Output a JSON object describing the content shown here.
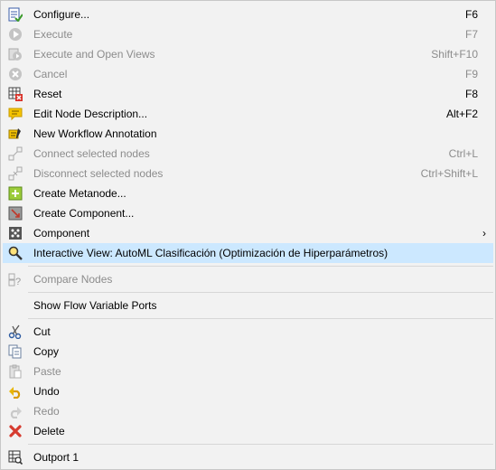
{
  "menu": {
    "items": [
      {
        "label": "Configure...",
        "shortcut": "F6",
        "icon": "configure-icon",
        "disabled": false
      },
      {
        "label": "Execute",
        "shortcut": "F7",
        "icon": "execute-icon",
        "disabled": true
      },
      {
        "label": "Execute and Open Views",
        "shortcut": "Shift+F10",
        "icon": "execute-open-views-icon",
        "disabled": true
      },
      {
        "label": "Cancel",
        "shortcut": "F9",
        "icon": "cancel-icon",
        "disabled": true
      },
      {
        "label": "Reset",
        "shortcut": "F8",
        "icon": "reset-icon",
        "disabled": false
      },
      {
        "label": "Edit Node Description...",
        "shortcut": "Alt+F2",
        "icon": "edit-description-icon",
        "disabled": false
      },
      {
        "label": "New Workflow Annotation",
        "shortcut": "",
        "icon": "annotation-icon",
        "disabled": false
      },
      {
        "label": "Connect selected nodes",
        "shortcut": "Ctrl+L",
        "icon": "connect-nodes-icon",
        "disabled": true
      },
      {
        "label": "Disconnect selected nodes",
        "shortcut": "Ctrl+Shift+L",
        "icon": "disconnect-nodes-icon",
        "disabled": true
      },
      {
        "label": "Create Metanode...",
        "shortcut": "",
        "icon": "metanode-icon",
        "disabled": false
      },
      {
        "label": "Create Component...",
        "shortcut": "",
        "icon": "component-create-icon",
        "disabled": false
      },
      {
        "label": "Component",
        "shortcut": "",
        "icon": "component-icon",
        "disabled": false
      },
      {
        "label": "Interactive View: AutoML Clasificación (Optimización de Hiperparámetros)",
        "shortcut": "",
        "icon": "interactive-view-icon",
        "disabled": false
      },
      {
        "label": "Compare Nodes",
        "shortcut": "",
        "icon": "compare-nodes-icon",
        "disabled": true
      },
      {
        "label": "Show Flow Variable Ports",
        "shortcut": "",
        "icon": "",
        "disabled": false
      },
      {
        "label": "Cut",
        "shortcut": "",
        "icon": "cut-icon",
        "disabled": false
      },
      {
        "label": "Copy",
        "shortcut": "",
        "icon": "copy-icon",
        "disabled": false
      },
      {
        "label": "Paste",
        "shortcut": "",
        "icon": "paste-icon",
        "disabled": true
      },
      {
        "label": "Undo",
        "shortcut": "",
        "icon": "undo-icon",
        "disabled": false
      },
      {
        "label": "Redo",
        "shortcut": "",
        "icon": "redo-icon",
        "disabled": true
      },
      {
        "label": "Delete",
        "shortcut": "",
        "icon": "delete-icon",
        "disabled": false
      },
      {
        "label": "Outport 1",
        "shortcut": "",
        "icon": "outport-icon",
        "disabled": false
      }
    ],
    "submenu_arrow": "›",
    "highlight_color": "#cce8ff"
  }
}
